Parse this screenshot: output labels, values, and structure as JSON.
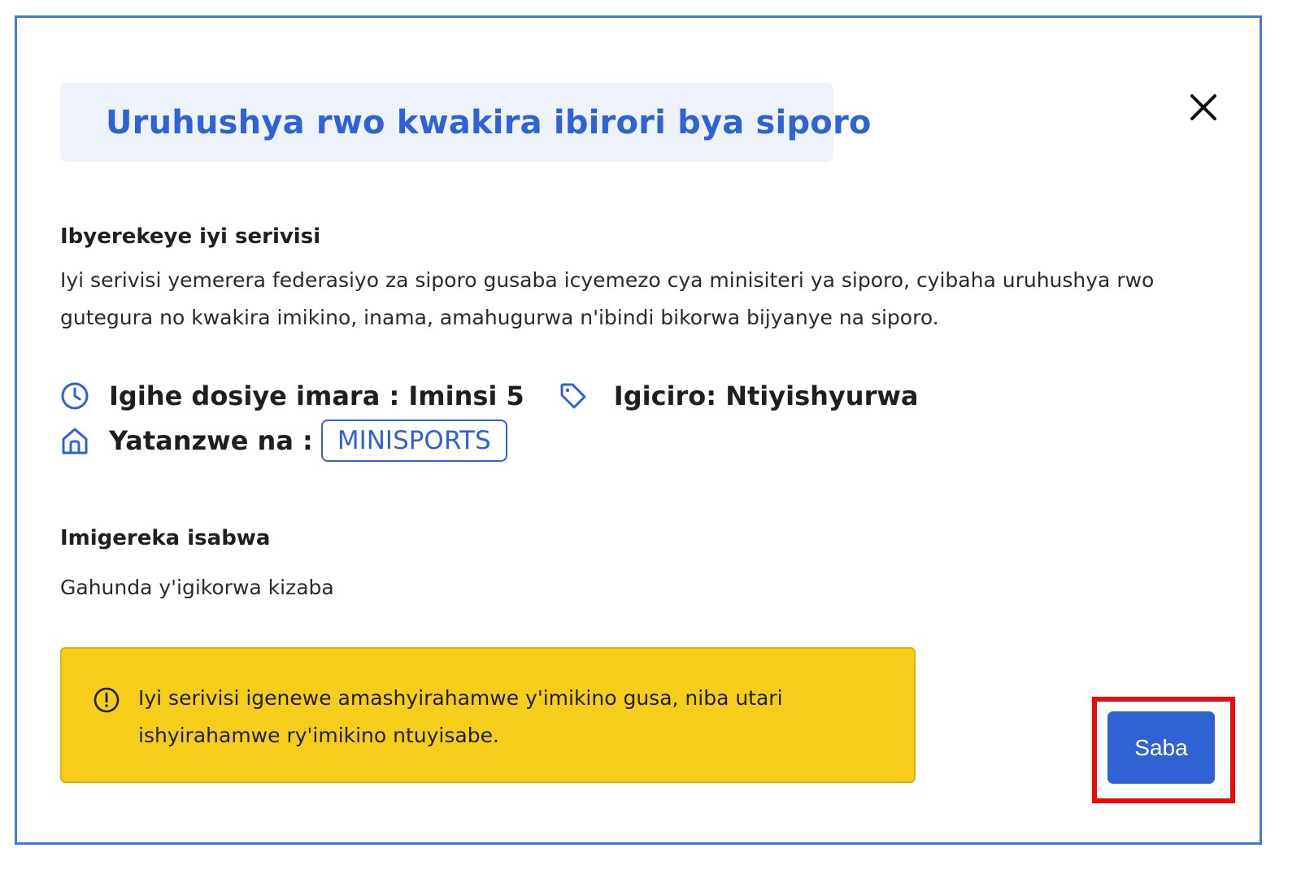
{
  "dialog": {
    "title": "Uruhushya rwo kwakira ibirori bya siporo",
    "about_heading": "Ibyerekeye iyi serivisi",
    "about_text": "Iyi serivisi yemerera federasiyo za siporo gusaba icyemezo cya minisiteri ya siporo, cyibaha uruhushya rwo gutegura no kwakira imikino, inama, amahugurwa n'ibindi bikorwa bijyanye na siporo.",
    "processing_time": "Igihe dosiye imara : Iminsi 5",
    "price": "Igiciro: Ntiyishyurwa",
    "provider_label": "Yatanzwe na :",
    "provider_name": "MINISPORTS",
    "requirements_heading": "Imigereka isabwa",
    "requirement_item": "Gahunda y'igikorwa kizaba",
    "notice_text": "Iyi serivisi igenewe amashyirahamwe y'imikino gusa, niba utari ishyirahamwe ry'imikino ntuyisabe.",
    "apply_button": "Saba"
  },
  "icons": {
    "close": "close-icon",
    "clock": "clock-icon",
    "tag": "tag-icon",
    "home": "home-icon",
    "alert": "alert-circle-icon"
  },
  "colors": {
    "accent": "#2f63d3",
    "frame_border": "#3f7bdc",
    "title_bg": "#eef3fb",
    "notice_bg": "#f7cd1b",
    "highlight": "#ee0a0a"
  }
}
